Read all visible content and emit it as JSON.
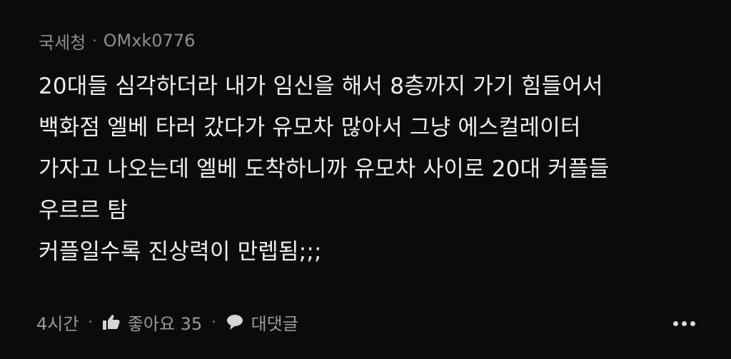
{
  "comment": {
    "category": "국세청",
    "separator": "·",
    "author": "OMxk0776",
    "lines": [
      "20대들 심각하더라 내가 임신을 해서 8층까지 가기 힘들어서",
      "백화점 엘베 타러 갔다가 유모차 많아서 그냥 에스컬레이터",
      "가자고 나오는데 엘베 도착하니까 유모차 사이로 20대 커플들",
      "우르르 탐",
      "커플일수록 진상력이 만렙됨;;;"
    ],
    "time": "4시간",
    "like_label": "좋아요 35",
    "reply_label": "대댓글",
    "icons": {
      "like": "thumbs-up-icon",
      "reply": "speech-bubble-icon",
      "more": "more-dots-icon"
    }
  }
}
